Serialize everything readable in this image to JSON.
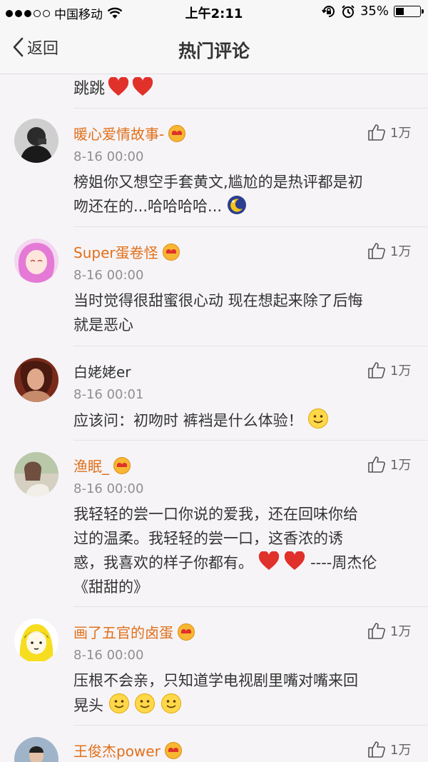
{
  "status_bar": {
    "carrier": "中国移动",
    "time": "上午2:11",
    "battery_percent": "35%",
    "battery_level": 0.35,
    "signal_bars": 3
  },
  "nav": {
    "back_label": "返回",
    "title": "热门评论"
  },
  "partial_comment": {
    "text": "跳跳"
  },
  "comments": [
    {
      "name": "暖心爱情故事-",
      "time": "8-16 00:00",
      "text_line1": "榜姐你又想空手套黄文,尴尬的是热评都是初",
      "text_line2": "吻还在的...哈哈哈哈...",
      "likes": "1万"
    },
    {
      "name": "Super蛋卷怪",
      "time": "8-16 00:00",
      "text_line1": "当时觉得很甜蜜很心动 现在想起来除了后悔",
      "text_line2": "就是恶心",
      "likes": "1万"
    },
    {
      "name": "白姥姥er",
      "time": "8-16 00:01",
      "text_line1": "应该问：初吻时 裤裆是什么体验！",
      "likes": "1万"
    },
    {
      "name": "渔眠_",
      "time": "8-16 00:00",
      "text_line1": "我轻轻的尝一口你说的爱我，还在回味你给",
      "text_line2": "过的温柔。我轻轻的尝一口，这香浓的诱",
      "text_line3a": "惑，我喜欢的样子你都有。",
      "text_line3b": "----周杰伦",
      "text_line4": "《甜甜的》",
      "likes": "1万"
    },
    {
      "name": "画了五官的卤蛋",
      "time": "8-16 00:00",
      "text_line1": "压根不会亲，只知道学电视剧里嘴对嘴来回",
      "text_line2": "晃头",
      "likes": "1万"
    },
    {
      "name": "王俊杰power",
      "likes": "1万"
    }
  ],
  "colors": {
    "username_accent": "#e1701a",
    "background": "#f6f4f7",
    "timestamp": "#8f8f8f",
    "heart": "#e0312b"
  },
  "icons": [
    "back-chevron-icon",
    "wifi-icon",
    "lock-rotation-icon",
    "alarm-icon",
    "battery-icon",
    "thumbs-up-icon",
    "heart-emoji-icon",
    "smile-emoji-icon",
    "member-badge-icon"
  ]
}
